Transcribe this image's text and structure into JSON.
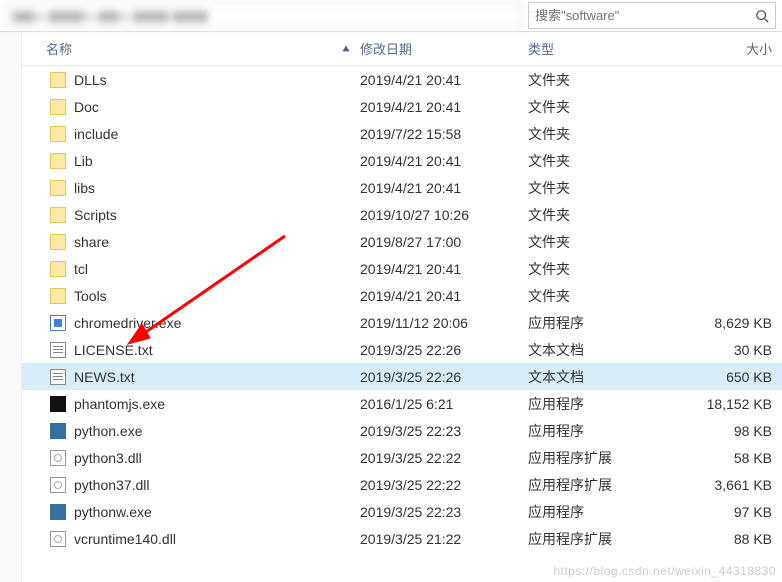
{
  "search": {
    "placeholder": "搜索\"software\""
  },
  "columns": {
    "name": "名称",
    "date": "修改日期",
    "type": "类型",
    "size": "大小"
  },
  "files": [
    {
      "name": "DLLs",
      "date": "2019/4/21 20:41",
      "type": "文件夹",
      "size": "",
      "icon": "folder"
    },
    {
      "name": "Doc",
      "date": "2019/4/21 20:41",
      "type": "文件夹",
      "size": "",
      "icon": "folder"
    },
    {
      "name": "include",
      "date": "2019/7/22 15:58",
      "type": "文件夹",
      "size": "",
      "icon": "folder"
    },
    {
      "name": "Lib",
      "date": "2019/4/21 20:41",
      "type": "文件夹",
      "size": "",
      "icon": "folder"
    },
    {
      "name": "libs",
      "date": "2019/4/21 20:41",
      "type": "文件夹",
      "size": "",
      "icon": "folder"
    },
    {
      "name": "Scripts",
      "date": "2019/10/27 10:26",
      "type": "文件夹",
      "size": "",
      "icon": "folder"
    },
    {
      "name": "share",
      "date": "2019/8/27 17:00",
      "type": "文件夹",
      "size": "",
      "icon": "folder"
    },
    {
      "name": "tcl",
      "date": "2019/4/21 20:41",
      "type": "文件夹",
      "size": "",
      "icon": "folder"
    },
    {
      "name": "Tools",
      "date": "2019/4/21 20:41",
      "type": "文件夹",
      "size": "",
      "icon": "folder"
    },
    {
      "name": "chromedriver.exe",
      "date": "2019/11/12 20:06",
      "type": "应用程序",
      "size": "8,629 KB",
      "icon": "exe"
    },
    {
      "name": "LICENSE.txt",
      "date": "2019/3/25 22:26",
      "type": "文本文档",
      "size": "30 KB",
      "icon": "txt"
    },
    {
      "name": "NEWS.txt",
      "date": "2019/3/25 22:26",
      "type": "文本文档",
      "size": "650 KB",
      "icon": "txt",
      "selected": true
    },
    {
      "name": "phantomjs.exe",
      "date": "2016/1/25 6:21",
      "type": "应用程序",
      "size": "18,152 KB",
      "icon": "black"
    },
    {
      "name": "python.exe",
      "date": "2019/3/25 22:23",
      "type": "应用程序",
      "size": "98 KB",
      "icon": "py"
    },
    {
      "name": "python3.dll",
      "date": "2019/3/25 22:22",
      "type": "应用程序扩展",
      "size": "58 KB",
      "icon": "dll"
    },
    {
      "name": "python37.dll",
      "date": "2019/3/25 22:22",
      "type": "应用程序扩展",
      "size": "3,661 KB",
      "icon": "dll"
    },
    {
      "name": "pythonw.exe",
      "date": "2019/3/25 22:23",
      "type": "应用程序",
      "size": "97 KB",
      "icon": "py"
    },
    {
      "name": "vcruntime140.dll",
      "date": "2019/3/25 21:22",
      "type": "应用程序扩展",
      "size": "88 KB",
      "icon": "dll"
    }
  ],
  "watermark": "https://blog.csdn.net/weixin_44318830"
}
